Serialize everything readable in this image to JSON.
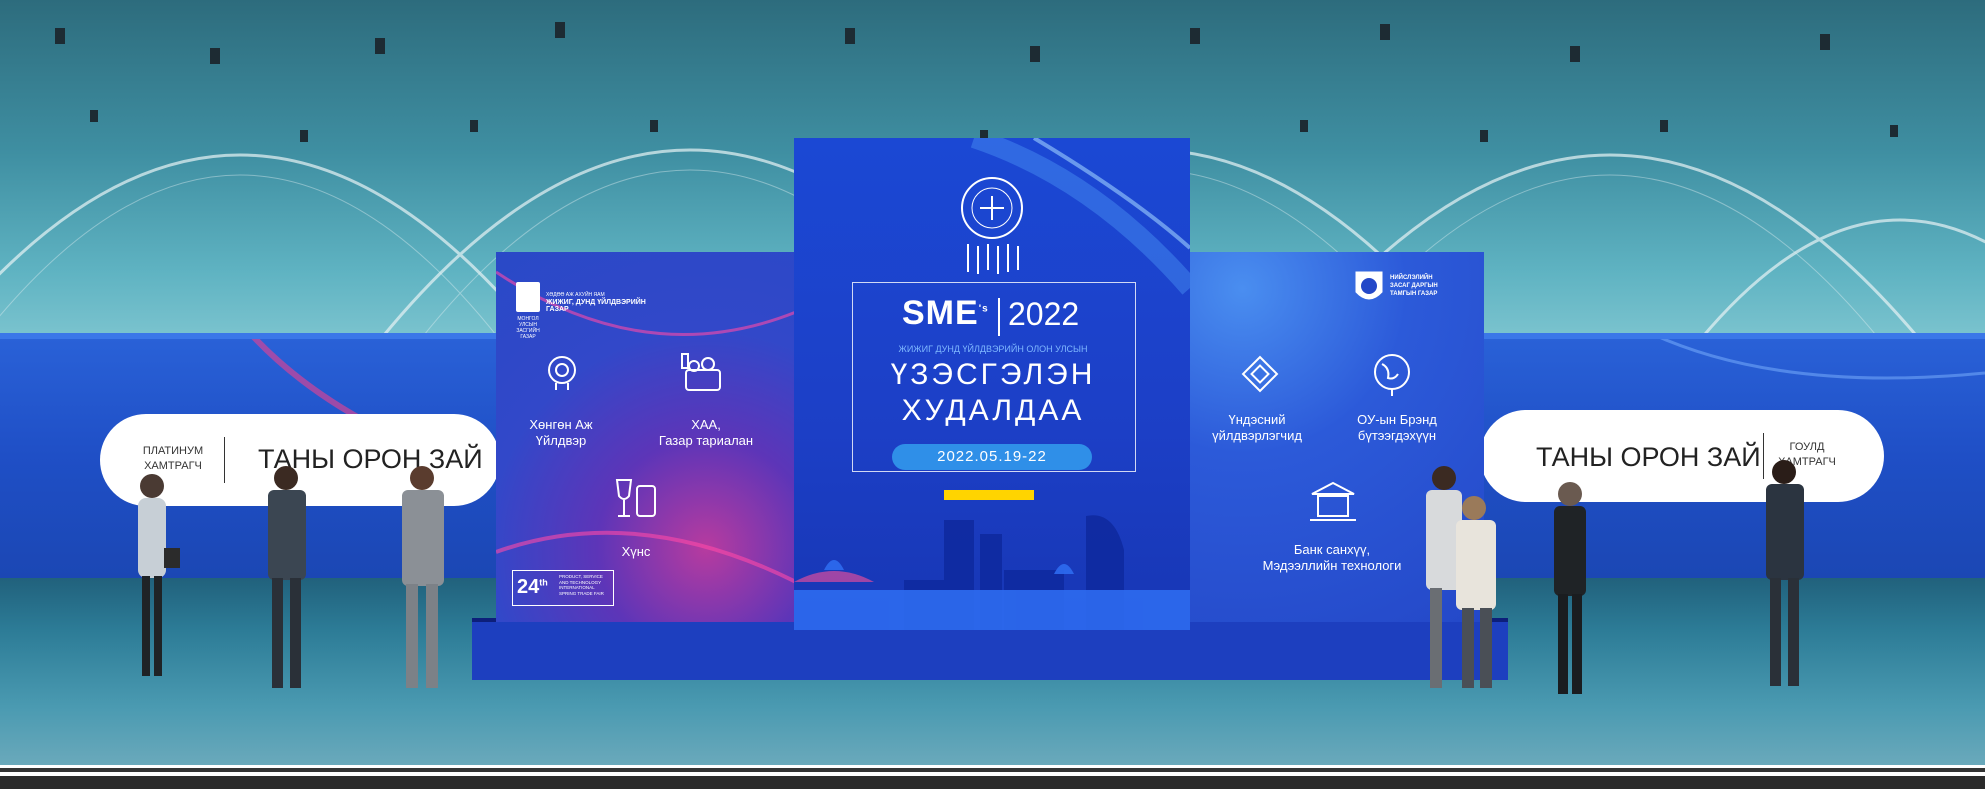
{
  "left_pill": {
    "tier_line1": "ПЛАТИНУМ",
    "tier_line2": "ХАМТРАГЧ",
    "space_text": "ТАНЫ ОРОН ЗАЙ"
  },
  "right_pill": {
    "space_text": "ТАНЫ ОРОН ЗАЙ",
    "tier_line1": "ГОУЛД",
    "tier_line2": "ХАМТРАГЧ"
  },
  "left_panel": {
    "org_line1": "МОНГОЛ УЛСЫН",
    "org_line2": "ЗАСГИЙН ГАЗАР",
    "org_text_line1": "ХӨДӨӨ АЖ АХУЙН ЯАМ",
    "org_text_line2": "ЖИЖИГ, ДУНД ҮЙЛДВЭРИЙН",
    "org_text_line3": "ГАЗАР",
    "item1": "Хөнгөн Аж Үйлдвэр",
    "item2_line1": "ХАА,",
    "item2_line2": "Газар тариалан",
    "item3": "Хүнс",
    "badge_number": "24",
    "badge_sup": "th",
    "badge_text": "PRODUCT, SERVICE AND TECHNOLOGY INTERNATIONAL SPRING TRADE FAIR"
  },
  "center_panel": {
    "brand": "SME",
    "brand_sup": "'s",
    "year": "2022",
    "subtitle": "ЖИЖИГ ДУНД ҮЙЛДВЭРИЙН ОЛОН УЛСЫН",
    "title_line1": "ҮЗЭСГЭЛЭН",
    "title_line2": "ХУДАЛДАА",
    "dates": "2022.05.19-22"
  },
  "right_panel": {
    "org_line1": "НИЙСЛЭЛИЙН",
    "org_line2": "ЗАСАГ ДАРГЫН",
    "org_line3": "ТАМГЫН ГАЗАР",
    "item1_line1": "Үндэсний",
    "item1_line2": "үйлдвэрлэгчид",
    "item2_line1": "ОУ-ын Брэнд",
    "item2_line2": "бүтээгдэхүүн",
    "item3_line1": "Банк санхүү,",
    "item3_line2": "Мэдээллийн технологи"
  },
  "colors": {
    "hall_teal": "#3f8fa2",
    "wall_blue": "#1f4fc6",
    "panel_blue": "#1c3fc6",
    "accent_magenta": "#c13b9a",
    "date_pill": "#2f8fe8"
  }
}
